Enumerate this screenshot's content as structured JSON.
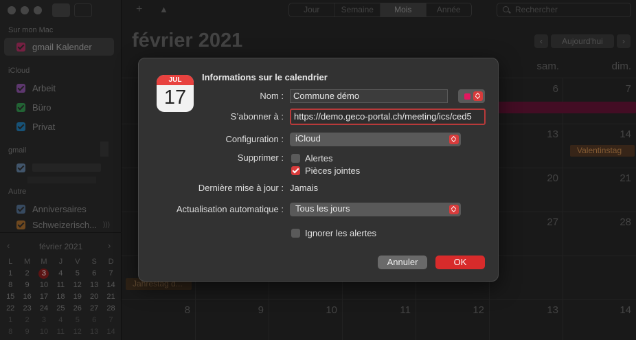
{
  "sidebar": {
    "sections": {
      "mac": "Sur mon Mac",
      "icloud": "iCloud",
      "gmail": "gmail",
      "other": "Autre"
    },
    "items": {
      "gmail_kalender": "gmail Kalender",
      "arbeit": "Arbeit",
      "buero": "Büro",
      "privat": "Privat",
      "anniversaires": "Anniversaires",
      "schweizerisch": "Schweizerisch..."
    },
    "colors": {
      "gmail_kalender": "#c0356b",
      "arbeit": "#9b59b6",
      "buero": "#34a853",
      "privat": "#1e88c8",
      "gmail_account": "#6d8fb3",
      "anniversaires": "#5b7a9e",
      "schweizerisch": "#b8722c"
    },
    "mini_calendar": {
      "title": "février 2021",
      "weekdays": [
        "L",
        "M",
        "M",
        "J",
        "V",
        "S",
        "D"
      ],
      "days": [
        [
          "1",
          "2",
          "3",
          "4",
          "5",
          "6",
          "7"
        ],
        [
          "8",
          "9",
          "10",
          "11",
          "12",
          "13",
          "14"
        ],
        [
          "15",
          "16",
          "17",
          "18",
          "19",
          "20",
          "21"
        ],
        [
          "22",
          "23",
          "24",
          "25",
          "26",
          "27",
          "28"
        ],
        [
          "1",
          "2",
          "3",
          "4",
          "5",
          "6",
          "7"
        ],
        [
          "8",
          "9",
          "10",
          "11",
          "12",
          "13",
          "14"
        ]
      ],
      "today": "3"
    }
  },
  "toolbar": {
    "add": "+",
    "views": [
      "Jour",
      "Semaine",
      "Mois",
      "Année"
    ],
    "active_view": "Mois",
    "search_placeholder": "Rechercher"
  },
  "calendar": {
    "month_title": "février 2021",
    "today_button": "Aujourd'hui",
    "weekday_headers": {
      "sat": "sam.",
      "sun": "dim."
    },
    "day_numbers": {
      "r1_sat": "6",
      "r1_sun": "7",
      "r2_sat": "13",
      "r2_sun": "14",
      "r3_sat": "20",
      "r3_sun": "21",
      "r4_sat": "27",
      "r4_sun": "28",
      "r6_c1": "8",
      "r6_c2": "9",
      "r6_c3": "10",
      "r6_c4": "11",
      "r6_c5": "12",
      "r6_c6": "13",
      "r6_c7": "14"
    },
    "events": {
      "valentinstag": "Valentinstag",
      "jahrestag": "Jahrestag d..."
    }
  },
  "dialog": {
    "title": "Informations sur le calendrier",
    "icon_month": "JUL",
    "icon_day": "17",
    "labels": {
      "name": "Nom :",
      "subscribe": "S’abonner à :",
      "configuration": "Configuration :",
      "remove": "Supprimer :",
      "last_update": "Dernière mise à jour :",
      "auto_refresh": "Actualisation automatique :"
    },
    "name_value": "Commune démo",
    "color": "#e3175f",
    "url_value": "https://demo.geco-portal.ch/meeting/ics/ced5",
    "configuration_value": "iCloud",
    "remove_alerts": {
      "label": "Alertes",
      "checked": false
    },
    "remove_attachments": {
      "label": "Pièces jointes",
      "checked": true
    },
    "last_update_value": "Jamais",
    "auto_refresh_value": "Tous les jours",
    "ignore_alerts": {
      "label": "Ignorer les alertes",
      "checked": false
    },
    "cancel_button": "Annuler",
    "ok_button": "OK"
  }
}
